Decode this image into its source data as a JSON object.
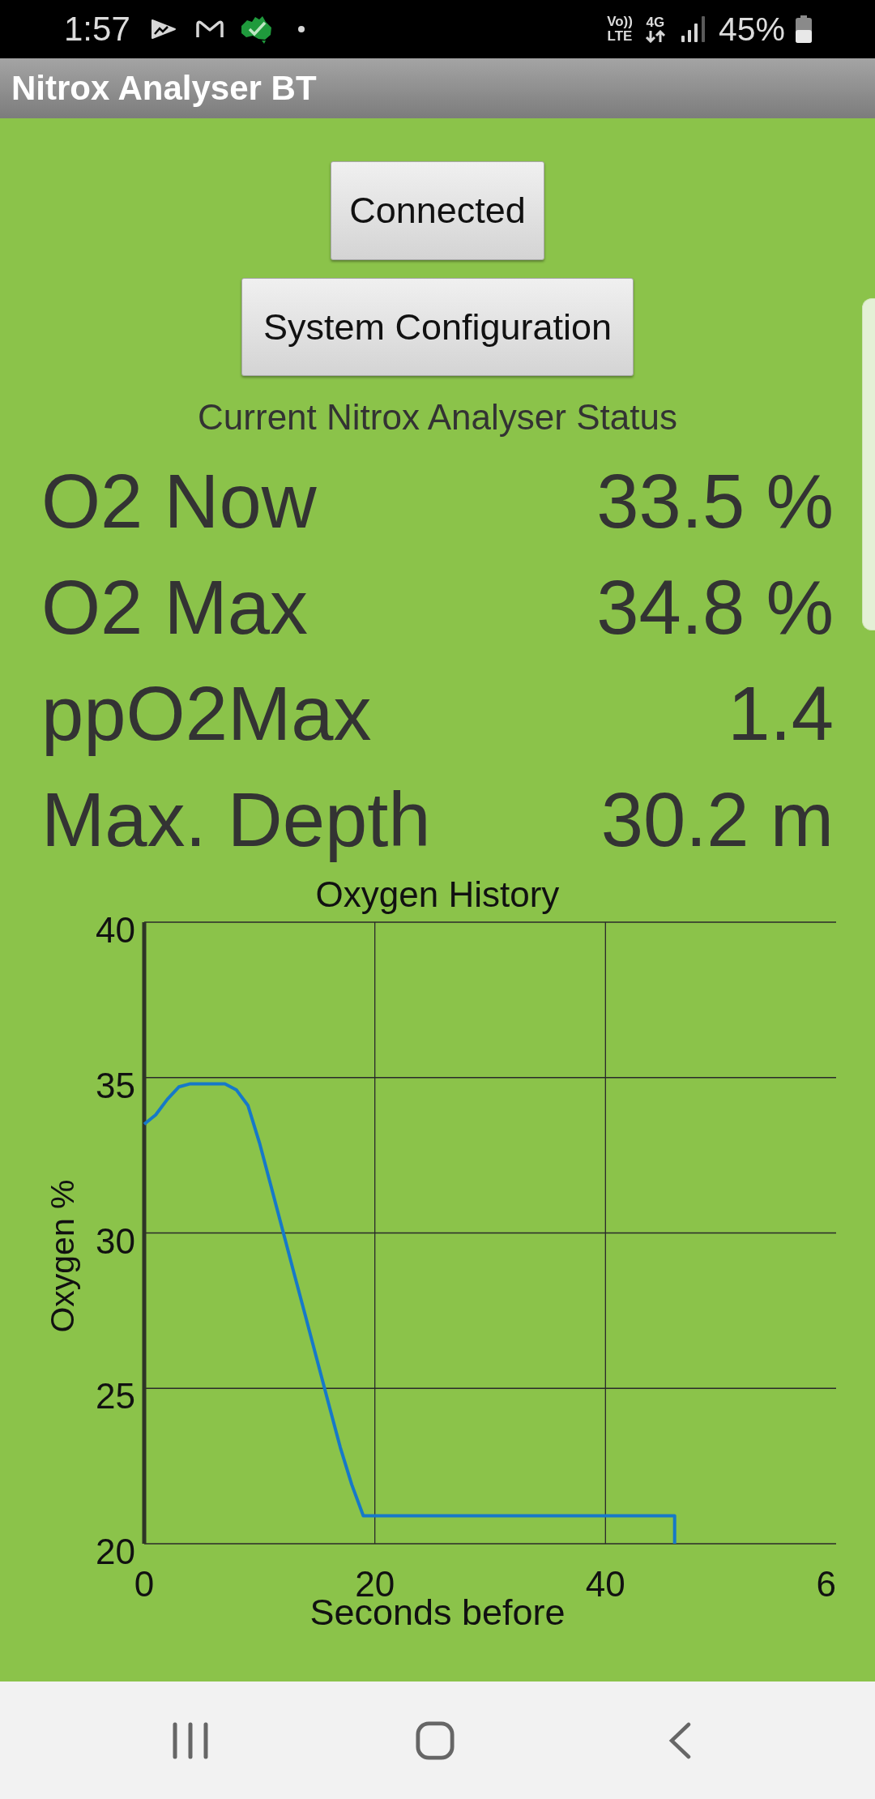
{
  "status_bar": {
    "time": "1:57",
    "voice_network": [
      "Vo))",
      "LTE"
    ],
    "data_network": "4G",
    "battery_percent": "45%"
  },
  "app_bar": {
    "title": "Nitrox Analyser BT"
  },
  "buttons": [
    {
      "label": "Connected"
    },
    {
      "label": "System Configuration"
    }
  ],
  "status_heading": "Current Nitrox Analyser Status",
  "readings": [
    {
      "label": "O2 Now",
      "value": "33.5 %"
    },
    {
      "label": "O2 Max",
      "value": "34.8 %"
    },
    {
      "label": "ppO2Max",
      "value": "1.4"
    },
    {
      "label": "Max. Depth",
      "value": "30.2 m"
    }
  ],
  "oxygen_history": {
    "chart_data": {
      "type": "line",
      "title": "Oxygen History",
      "xlabel": "Seconds before",
      "ylabel": "Oxygen %",
      "x": [
        0,
        1,
        2,
        3,
        4,
        5,
        6,
        7,
        8,
        9,
        10,
        11,
        12,
        13,
        14,
        15,
        16,
        17,
        18,
        19,
        46,
        46
      ],
      "series": [
        {
          "color": "#1679c8",
          "values": [
            33.5,
            33.8,
            34.3,
            34.7,
            34.8,
            34.8,
            34.8,
            34.8,
            34.6,
            34.1,
            32.9,
            31.5,
            30.1,
            28.7,
            27.3,
            25.9,
            24.5,
            23.1,
            21.9,
            20.9,
            20.9,
            20.0
          ]
        }
      ],
      "xlim": [
        0,
        60
      ],
      "ylim": [
        20,
        40
      ],
      "xticks": [
        0,
        20,
        40
      ],
      "yticks": [
        20,
        25,
        30,
        35,
        40
      ],
      "grid": true
    },
    "cut_off_axis_end_label": "6"
  }
}
